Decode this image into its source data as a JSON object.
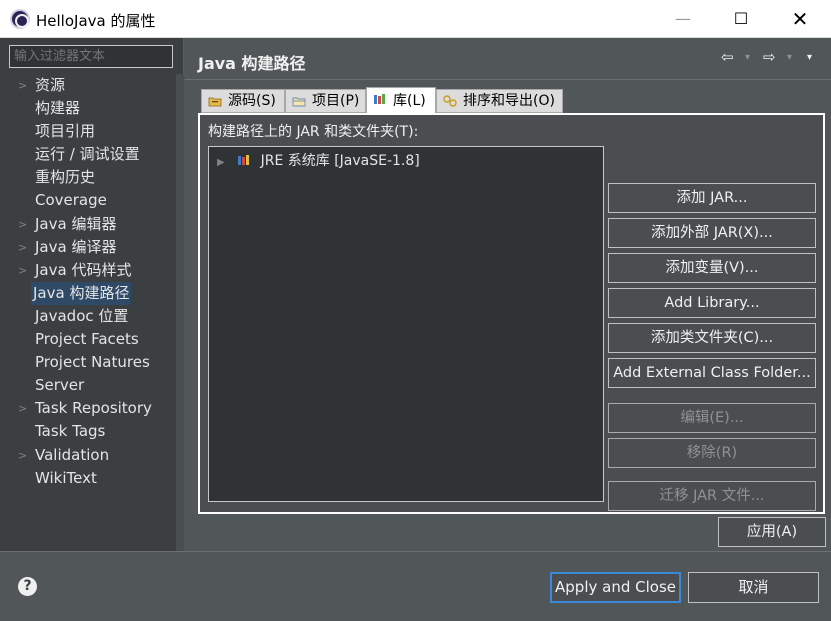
{
  "window": {
    "title": "HelloJava 的属性",
    "minimize_glyph": "—",
    "maximize_glyph": "☐",
    "close_glyph": "✕"
  },
  "filter": {
    "placeholder": "输入过滤器文本"
  },
  "tree": {
    "items": [
      {
        "label": "资源",
        "expandable": true
      },
      {
        "label": "构建器",
        "expandable": false
      },
      {
        "label": "项目引用",
        "expandable": false
      },
      {
        "label": "运行 / 调试设置",
        "expandable": false
      },
      {
        "label": "重构历史",
        "expandable": false
      },
      {
        "label": "Coverage",
        "expandable": false
      },
      {
        "label": "Java 编辑器",
        "expandable": true
      },
      {
        "label": "Java 编译器",
        "expandable": true
      },
      {
        "label": "Java 代码样式",
        "expandable": true
      },
      {
        "label": "Java 构建路径",
        "expandable": false,
        "selected": true
      },
      {
        "label": "Javadoc 位置",
        "expandable": false
      },
      {
        "label": "Project Facets",
        "expandable": false
      },
      {
        "label": "Project Natures",
        "expandable": false
      },
      {
        "label": "Server",
        "expandable": false
      },
      {
        "label": "Task Repository",
        "expandable": true
      },
      {
        "label": "Task Tags",
        "expandable": false
      },
      {
        "label": "Validation",
        "expandable": true
      },
      {
        "label": "WikiText",
        "expandable": false
      }
    ]
  },
  "page": {
    "title": "Java 构建路径",
    "nav": {
      "back": "⇦",
      "forward": "⇨",
      "dropdown": "▾"
    }
  },
  "tabs": [
    {
      "label": "源码(S)",
      "icon": "source-folder-icon"
    },
    {
      "label": "项目(P)",
      "icon": "project-icon"
    },
    {
      "label": "库(L)",
      "icon": "library-icon",
      "active": true
    },
    {
      "label": "排序和导出(O)",
      "icon": "order-export-icon"
    }
  ],
  "libraries": {
    "label": "构建路径上的 JAR 和类文件夹(T):",
    "entries": [
      {
        "label": "JRE 系统库 [JavaSE-1.8]",
        "icon": "jre-library-icon"
      }
    ]
  },
  "buttons": {
    "add_jar": "添加 JAR...",
    "add_external_jar": "添加外部 JAR(X)...",
    "add_variable": "添加变量(V)...",
    "add_library": "Add Library...",
    "add_class_folder": "添加类文件夹(C)...",
    "add_external_class_folder": "Add External Class Folder...",
    "edit": "编辑(E)...",
    "remove": "移除(R)",
    "migrate_jar": "迁移 JAR 文件...",
    "apply": "应用(A)"
  },
  "footer": {
    "help_glyph": "?",
    "apply_and_close": "Apply and Close",
    "cancel": "取消"
  },
  "colors": {
    "dialog_background": "#515658",
    "tree_background": "#2f3335",
    "selection": "#2e4a67",
    "default_button_border": "#3b8ad8"
  }
}
